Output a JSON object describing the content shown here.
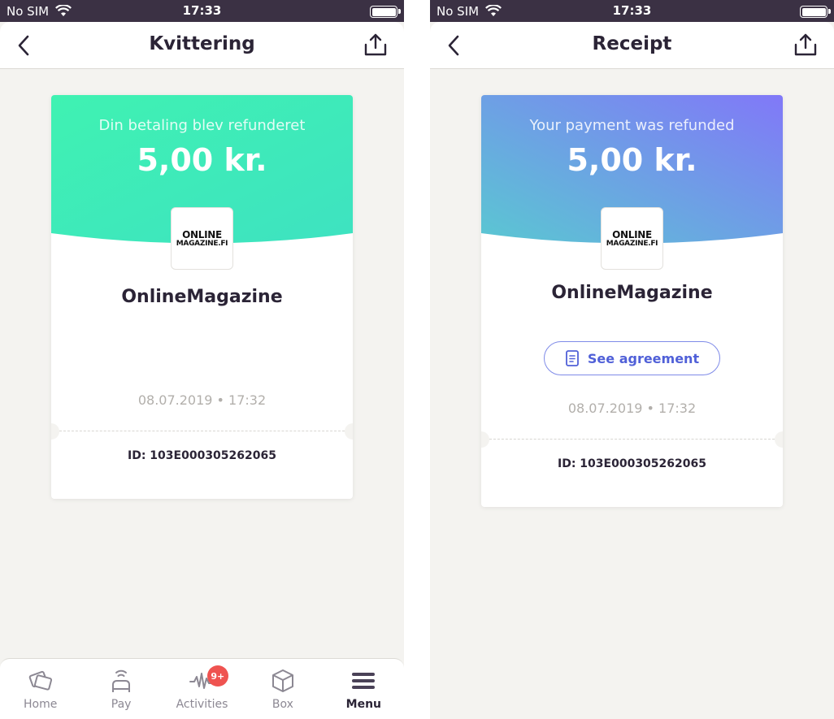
{
  "status_bar": {
    "carrier": "No SIM",
    "time": "17:33"
  },
  "left": {
    "nav_title": "Kvittering",
    "status_text": "Din betaling blev refunderet",
    "amount": "5,00 kr.",
    "logo_line1": "ONLINE",
    "logo_line2": "MAGAZINE.FI",
    "merchant": "OnlineMagazine",
    "date": "08.07.2019",
    "time": "17:32",
    "transaction_id": "ID: 103E000305262065",
    "gradient_start": "#3ff2b2",
    "gradient_end": "#3ee2c1"
  },
  "right": {
    "nav_title": "Receipt",
    "status_text": "Your payment was refunded",
    "amount": "5,00 kr.",
    "logo_line1": "ONLINE",
    "logo_line2": "MAGAZINE.FI",
    "merchant": "OnlineMagazine",
    "agreement_button": "See agreement",
    "date": "08.07.2019",
    "time": "17:32",
    "transaction_id": "ID: 103E000305262065",
    "gradient_start": "#5ac7d2",
    "gradient_end": "#8178f8"
  },
  "tabbar": {
    "tabs": [
      {
        "label": "Home",
        "icon": "home-cards-icon"
      },
      {
        "label": "Pay",
        "icon": "contactless-pay-icon"
      },
      {
        "label": "Activities",
        "icon": "activity-wave-icon",
        "badge": "9+"
      },
      {
        "label": "Box",
        "icon": "box-icon"
      },
      {
        "label": "Menu",
        "icon": "menu-icon",
        "active": true
      }
    ]
  }
}
